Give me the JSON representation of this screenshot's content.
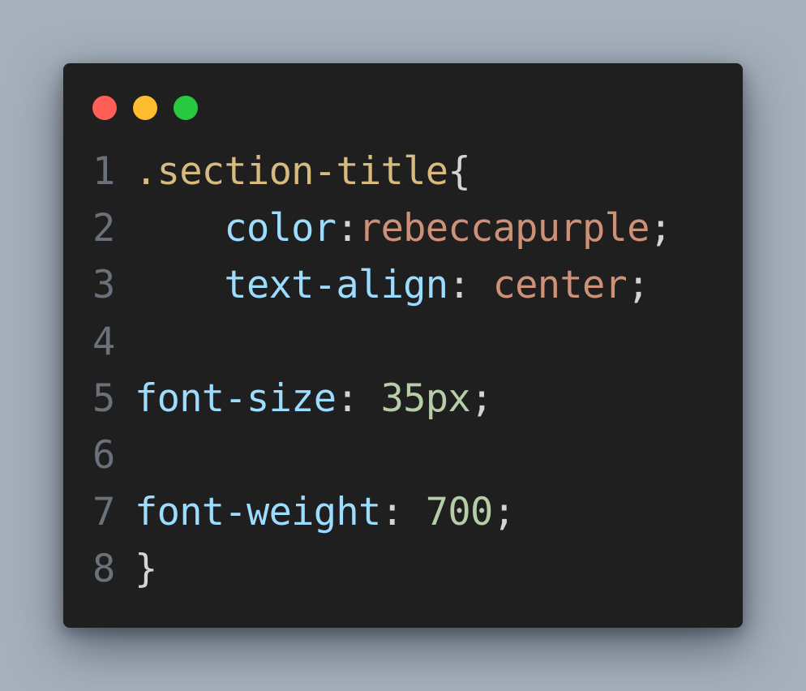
{
  "window": {
    "controls": [
      {
        "name": "close",
        "color": "#ff5f57"
      },
      {
        "name": "minimize",
        "color": "#febc2e"
      },
      {
        "name": "zoom",
        "color": "#28c840"
      }
    ]
  },
  "code": {
    "lines": [
      {
        "number": "1",
        "indent": "",
        "tokens": [
          {
            "text": ".section-title",
            "kind": "selector"
          },
          {
            "text": "{",
            "kind": "punctuation"
          }
        ]
      },
      {
        "number": "2",
        "indent": "    ",
        "tokens": [
          {
            "text": "color",
            "kind": "property"
          },
          {
            "text": ":",
            "kind": "punctuation"
          },
          {
            "text": "rebeccapurple",
            "kind": "string"
          },
          {
            "text": ";",
            "kind": "punctuation"
          }
        ]
      },
      {
        "number": "3",
        "indent": "    ",
        "tokens": [
          {
            "text": "text-align",
            "kind": "property"
          },
          {
            "text": ": ",
            "kind": "punctuation"
          },
          {
            "text": "center",
            "kind": "string"
          },
          {
            "text": ";",
            "kind": "punctuation"
          }
        ]
      },
      {
        "number": "4",
        "indent": "",
        "tokens": []
      },
      {
        "number": "5",
        "indent": "",
        "tokens": [
          {
            "text": "font-size",
            "kind": "property"
          },
          {
            "text": ": ",
            "kind": "punctuation"
          },
          {
            "text": "35px",
            "kind": "number"
          },
          {
            "text": ";",
            "kind": "punctuation"
          }
        ]
      },
      {
        "number": "6",
        "indent": "",
        "tokens": []
      },
      {
        "number": "7",
        "indent": "",
        "tokens": [
          {
            "text": "font-weight",
            "kind": "property"
          },
          {
            "text": ": ",
            "kind": "punctuation"
          },
          {
            "text": "700",
            "kind": "number"
          },
          {
            "text": ";",
            "kind": "punctuation"
          }
        ]
      },
      {
        "number": "8",
        "indent": "",
        "tokens": [
          {
            "text": "}",
            "kind": "punctuation"
          }
        ]
      }
    ]
  }
}
